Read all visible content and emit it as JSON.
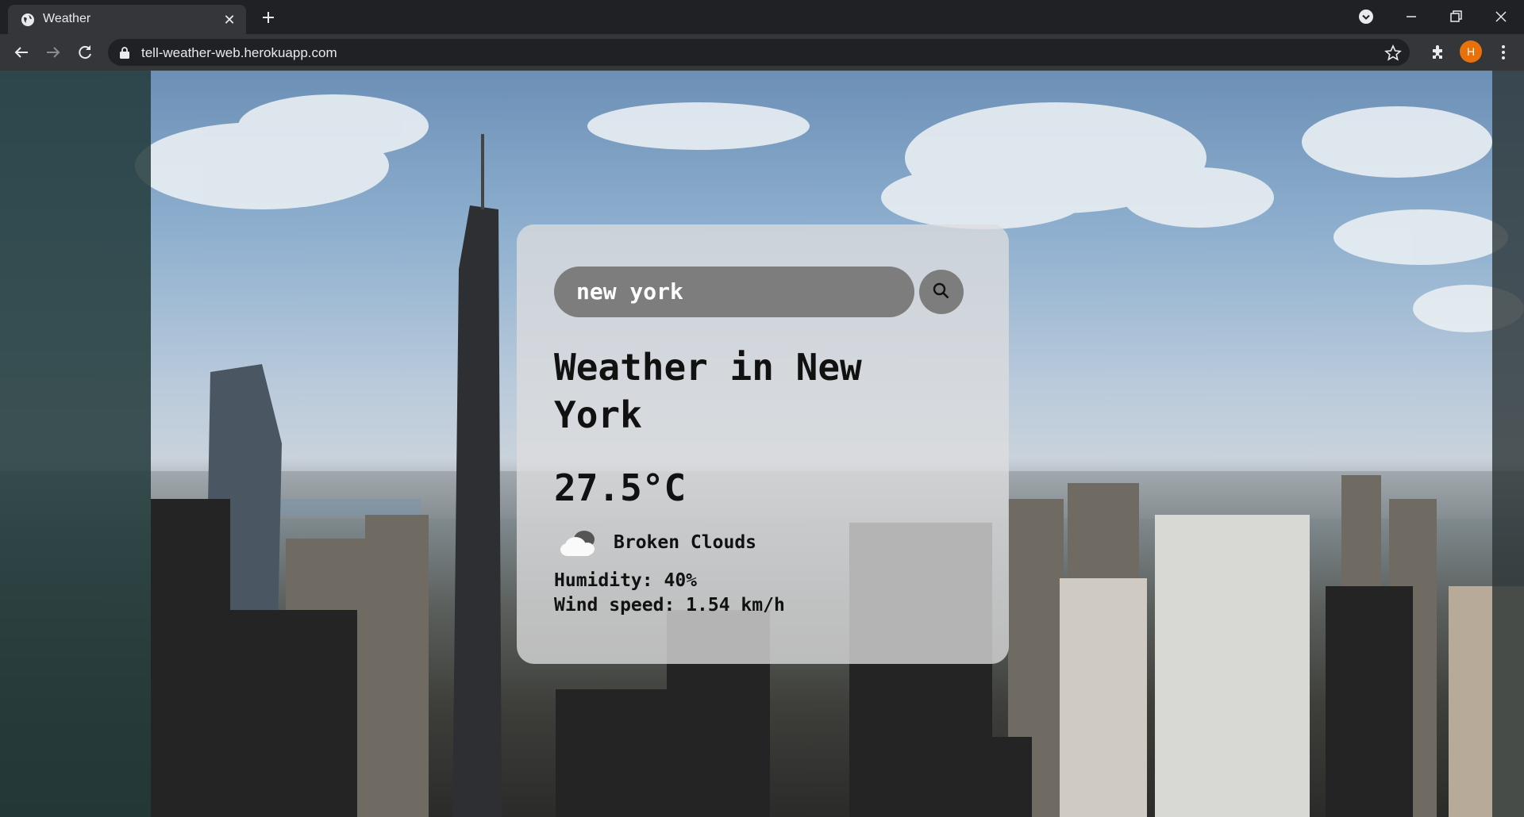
{
  "browser": {
    "tab_title": "Weather",
    "url": "tell-weather-web.herokuapp.com",
    "avatar_letter": "H",
    "accent_color": "#e8710a"
  },
  "search": {
    "value": "new york",
    "icon": "search-icon"
  },
  "weather": {
    "heading": "Weather in New York",
    "temperature": "27.5°C",
    "condition_icon": "cloud-icon",
    "condition": "Broken Clouds",
    "humidity": "Humidity: 40%",
    "wind": "Wind speed: 1.54 km/h"
  }
}
